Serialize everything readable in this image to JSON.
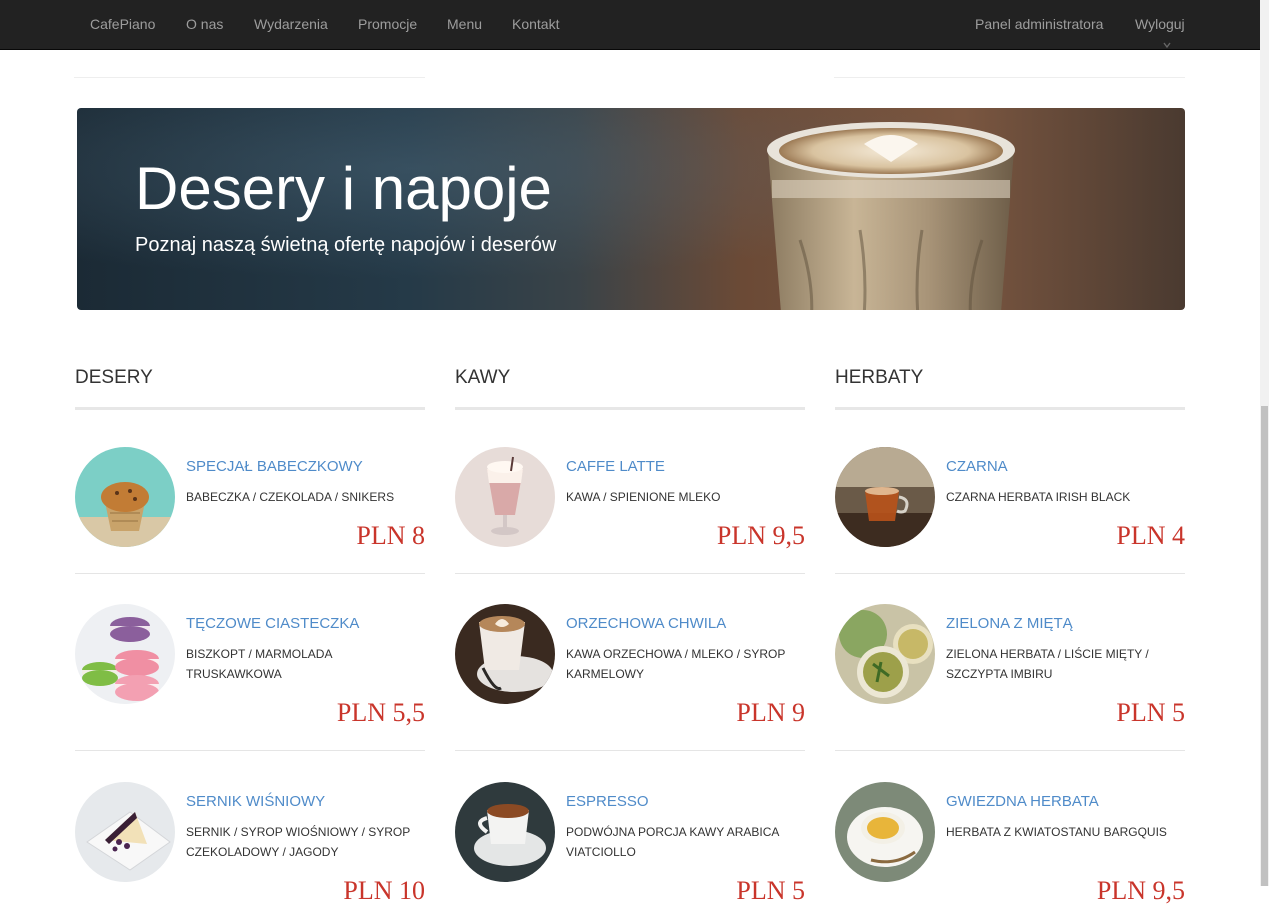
{
  "nav": {
    "brand": "CafePiano",
    "links": [
      "O nas",
      "Wydarzenia",
      "Promocje",
      "Menu",
      "Kontakt"
    ],
    "admin": "Panel administratora",
    "logout": "Wyloguj"
  },
  "hero": {
    "title": "Desery i napoje",
    "subtitle": "Poznaj naszą świetną ofertę napojów i deserów"
  },
  "columns": [
    {
      "heading": "DESERY",
      "items": [
        {
          "name": "SPECJAŁ BABECZKOWY",
          "desc": "BABECZKA / CZEKOLADA / SNIKERS",
          "price": "PLN 8"
        },
        {
          "name": "TĘCZOWE CIASTECZKA",
          "desc": "BISZKOPT / MARMOLADA TRUSKAWKOWA",
          "price": "PLN 5,5"
        },
        {
          "name": "SERNIK WIŚNIOWY",
          "desc": "SERNIK / SYROP WIOŚNIOWY / SYROP CZEKOLADOWY / JAGODY",
          "price": "PLN 10"
        }
      ]
    },
    {
      "heading": "KAWY",
      "items": [
        {
          "name": "CAFFE LATTE",
          "desc": "KAWA / SPIENIONE MLEKO",
          "price": "PLN 9,5"
        },
        {
          "name": "ORZECHOWA CHWILA",
          "desc": "KAWA ORZECHOWA / MLEKO / SYROP KARMELOWY",
          "price": "PLN 9"
        },
        {
          "name": "ESPRESSO",
          "desc": "PODWÓJNA PORCJA KAWY ARABICA VIATCIOLLO",
          "price": "PLN 5"
        }
      ]
    },
    {
      "heading": "HERBATY",
      "items": [
        {
          "name": "CZARNA",
          "desc": "CZARNA HERBATA IRISH BLACK",
          "price": "PLN 4"
        },
        {
          "name": "ZIELONA Z MIĘTĄ",
          "desc": "ZIELONA HERBATA / LIŚCIE MIĘTY / SZCZYPTA IMBIRU",
          "price": "PLN 5"
        },
        {
          "name": "GWIEZDNA HERBATA",
          "desc": "HERBATA Z KWIATOSTANU BARGQUIS",
          "price": "PLN 9,5"
        }
      ]
    }
  ],
  "icons": {
    "top_fragment": "chevron-icon"
  },
  "colors": {
    "navbar": "#222222",
    "nav_text": "#9d9d9d",
    "item_link": "#4f8bc9",
    "price": "#c9352b"
  }
}
